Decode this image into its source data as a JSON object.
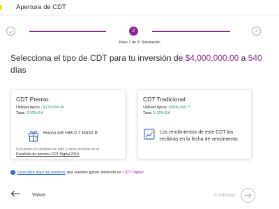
{
  "header": {
    "title": "Apertura de CDT"
  },
  "stepper": {
    "step1_icon": "check-icon",
    "step2": "2",
    "step3": "3",
    "caption_prefix": "Paso 2 de 3:",
    "caption_step": "Simulación"
  },
  "heading": {
    "prefix": "Selecciona el tipo de CDT para tu inversión de ",
    "amount": "$4,000,000.00",
    "mid": " a ",
    "days_value": "540",
    "days_label": "días"
  },
  "card_premio": {
    "title": "CDT Premio",
    "utilidad_label": "Utilidad Aprox.: ",
    "utilidad_value": "$178,804.46",
    "tasa_label": "Tasa: ",
    "tasa_value": "3.00% EA",
    "prize": "Horno AR HM-0.7 INOX E",
    "footer_text": "Encuentra los detalles de este y otros premios en el",
    "footer_link": "Portafolio de premios CDT Digital 2019."
  },
  "card_tradicional": {
    "title": "CDT Tradicional",
    "utilidad_label": "Utilidad Aprox.: ",
    "utilidad_value": "$308,496.77",
    "tasa_label": "Tasa: ",
    "tasa_value": "5.15% EA",
    "description": "Los rendimientos de este CDT los recibirás en la fecha de vencimiento."
  },
  "info": {
    "link": "Descubre aquí los premios",
    "middle": " que puedes ganar abriendo un ",
    "product": "CDT Digital."
  },
  "footer": {
    "back_label": "Volver",
    "next_label": "Continuar"
  },
  "colors": {
    "accent_purple": "#8a2a92",
    "value_green": "#1e9c5a",
    "link_blue": "#1d5fbd",
    "brand_yellow": "#fdda24"
  }
}
